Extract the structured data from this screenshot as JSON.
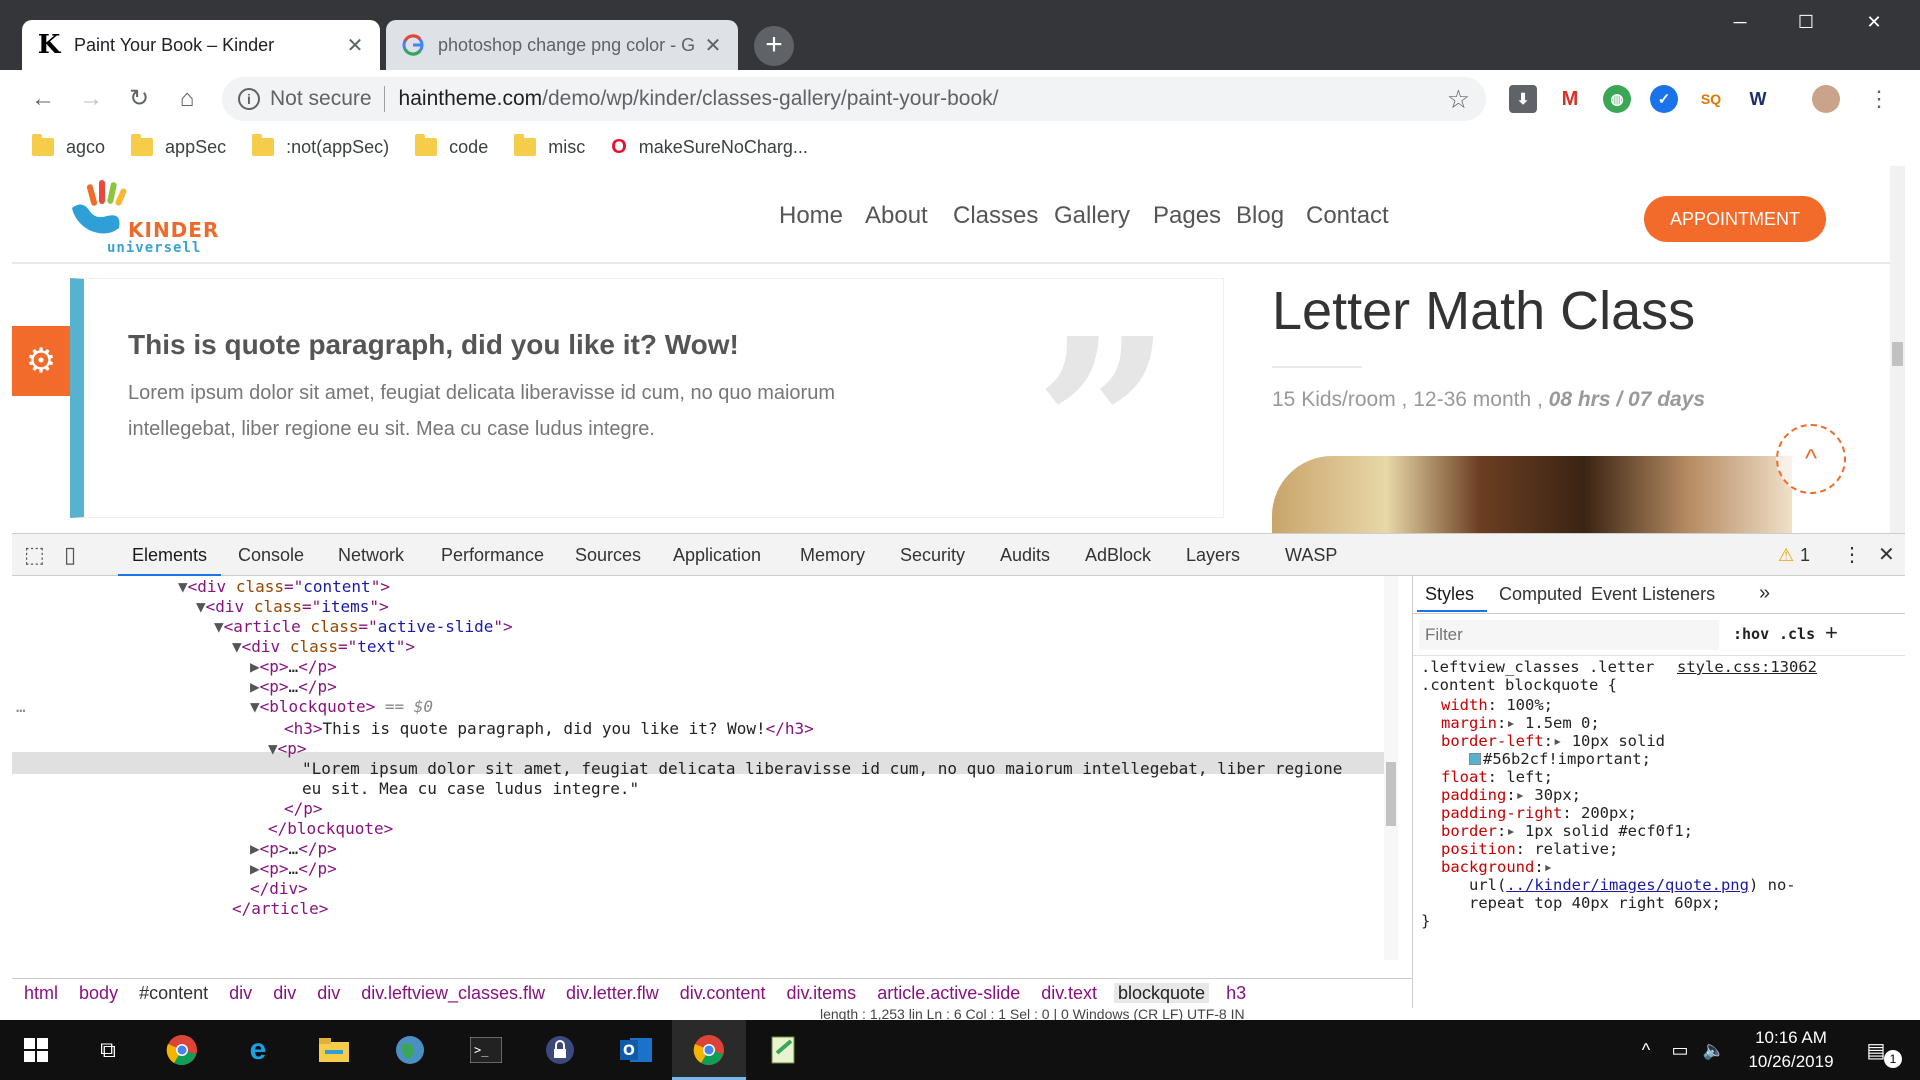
{
  "browser": {
    "tabs": [
      {
        "title": "Paint Your Book – Kinder",
        "favicon": "K"
      },
      {
        "title": "photoshop change png color - G",
        "favicon": "G"
      }
    ],
    "address": {
      "security_label": "Not secure",
      "host": "haintheme.com",
      "path": "/demo/wp/kinder/classes-gallery/paint-your-book/"
    },
    "bookmarks": [
      "agco",
      "appSec",
      ":not(appSec)",
      "code",
      "misc",
      "makeSureNoCharg..."
    ]
  },
  "site": {
    "logo": {
      "line1": "KINDER",
      "line2": "universell"
    },
    "nav": [
      "Home",
      "About",
      "Classes",
      "Gallery",
      "Pages",
      "Blog",
      "Contact"
    ],
    "cta": "APPOINTMENT",
    "quote": {
      "heading": "This is quote paragraph, did you like it? Wow!",
      "body": "Lorem ipsum dolor sit amet, feugiat delicata liberavisse id cum, no quo maiorum intellegebat, liber regione eu sit. Mea cu case ludus integre."
    },
    "class_title": "Letter Math Class",
    "class_meta": "15 Kids/room , 12-36 month , ",
    "class_meta_em": "08 hrs / 07 days"
  },
  "devtools": {
    "tabs": [
      "Elements",
      "Console",
      "Network",
      "Performance",
      "Sources",
      "Application",
      "Memory",
      "Security",
      "Audits",
      "AdBlock",
      "Layers",
      "WASP"
    ],
    "warning_count": "1",
    "selected_marker": "== $0",
    "dom": {
      "h3_text": "This is quote paragraph, did you like it? Wow!",
      "p_text_1": "\"Lorem ipsum dolor sit amet, feugiat delicata liberavisse id cum, no quo maiorum intellegebat, liber regione",
      "p_text_2": "eu sit. Mea cu case ludus integre.\""
    },
    "breadcrumbs": [
      "html",
      "body",
      "#content",
      "div",
      "div",
      "div",
      "div.leftview_classes.flw",
      "div.letter.flw",
      "div.content",
      "div.items",
      "article.active-slide",
      "div.text",
      "blockquote",
      "h3"
    ],
    "styles": {
      "tabs": [
        "Styles",
        "Computed",
        "Event Listeners"
      ],
      "filter_placeholder": "Filter",
      "hov": ":hov",
      "cls": ".cls",
      "selector_1": ".leftview_classes .letter",
      "selector_2": ".content blockquote {",
      "source": "style.css:13062",
      "props": [
        {
          "name": "width",
          "value": "100%;"
        },
        {
          "name": "margin",
          "value": "1.5em 0;"
        },
        {
          "name": "border-left",
          "value": "10px solid"
        },
        {
          "name": "",
          "value": "#56b2cf!important;"
        },
        {
          "name": "float",
          "value": "left;"
        },
        {
          "name": "padding",
          "value": "30px;"
        },
        {
          "name": "padding-right",
          "value": "200px;"
        },
        {
          "name": "border",
          "value": "1px solid #ecf0f1;"
        },
        {
          "name": "position",
          "value": "relative;"
        },
        {
          "name": "background",
          "value": ""
        }
      ],
      "bg_url": "../kinder/images/quote.png",
      "bg_rest": ") no-",
      "bg_rest2": "repeat top 40px right 60px;"
    },
    "status_remnant": "length : 1,253   lin Ln : 6    Col : 1    Sel : 0 | 0                                          Windows (CR LF)    UTF-8                     IN"
  },
  "taskbar": {
    "time": "10:16 AM",
    "date": "10/26/2019",
    "notification_count": "1"
  },
  "colors": {
    "accent_orange": "#f26b2a",
    "quote_border": "#56b2cf",
    "chrome_dark": "#35363a"
  }
}
